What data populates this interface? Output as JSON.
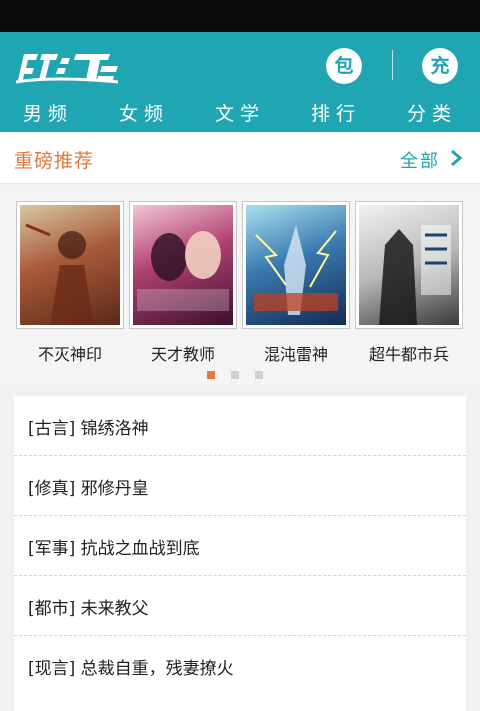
{
  "app": {
    "bag_label": "包",
    "charge_label": "充",
    "brand_color": "#20a5b3",
    "accent_color": "#e07a3a"
  },
  "nav": [
    {
      "label": "男频"
    },
    {
      "label": "女频"
    },
    {
      "label": "文学"
    },
    {
      "label": "排行"
    },
    {
      "label": "分类"
    }
  ],
  "section": {
    "title": "重磅推荐",
    "more_label": "全部"
  },
  "books": [
    {
      "title": "不灭神印"
    },
    {
      "title": "天才教师"
    },
    {
      "title": "混沌雷神"
    },
    {
      "title": "超牛都市兵"
    }
  ],
  "carousel": {
    "pages": 3,
    "active": 1
  },
  "list": [
    {
      "text": "[古言] 锦绣洛神"
    },
    {
      "text": "[修真] 邪修丹皇"
    },
    {
      "text": "[军事] 抗战之血战到底"
    },
    {
      "text": "[都市] 未来教父"
    },
    {
      "text": "[现言] 总裁自重，残妻撩火"
    }
  ]
}
